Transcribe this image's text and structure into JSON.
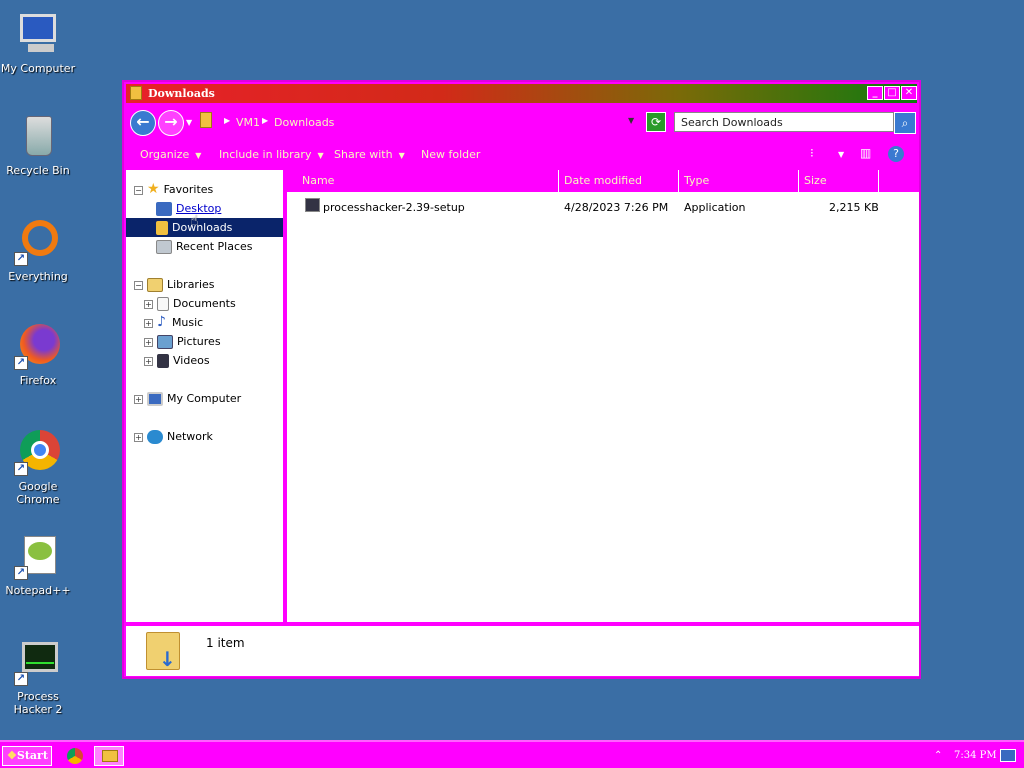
{
  "desktop": {
    "icons": [
      {
        "label": "My Computer"
      },
      {
        "label": "Recycle Bin"
      },
      {
        "label": "Everything"
      },
      {
        "label": "Firefox"
      },
      {
        "label": "Google Chrome"
      },
      {
        "label": "Notepad++"
      },
      {
        "label": "Process Hacker 2"
      }
    ]
  },
  "window": {
    "title": "Downloads",
    "address": {
      "segment1": "VM1",
      "segment2": "Downloads"
    },
    "search": {
      "placeholder": "Search Downloads"
    },
    "toolbar": {
      "organize": "Organize",
      "include_in_library": "Include in library",
      "share_with": "Share with",
      "new_folder": "New folder"
    },
    "nav": {
      "favorites": "Favorites",
      "desktop": "Desktop",
      "downloads": "Downloads",
      "recent_places": "Recent Places",
      "libraries": "Libraries",
      "documents": "Documents",
      "music": "Music",
      "pictures": "Pictures",
      "videos": "Videos",
      "my_computer": "My Computer",
      "network": "Network"
    },
    "columns": {
      "name": "Name",
      "date_modified": "Date modified",
      "type": "Type",
      "size": "Size"
    },
    "files": [
      {
        "name": "processhacker-2.39-setup",
        "date_modified": "4/28/2023 7:26 PM",
        "type": "Application",
        "size": "2,215 KB"
      }
    ],
    "details": {
      "count": "1 item"
    }
  },
  "taskbar": {
    "start": "Start",
    "clock": "7:34 PM"
  },
  "colors": {
    "accent": "#ff00ff",
    "desktop": "#3a6ea5",
    "selection": "#0a246a"
  }
}
